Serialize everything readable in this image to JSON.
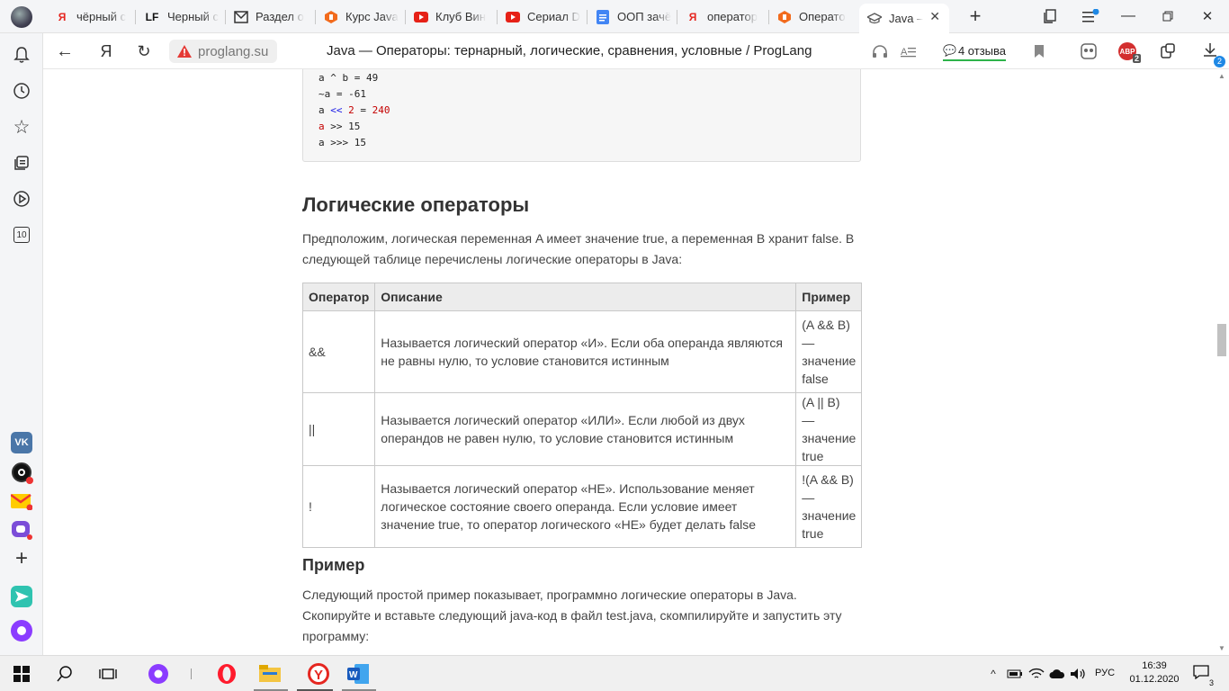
{
  "tabs": [
    {
      "label": "чёрный с",
      "favicon": "yandex-favicon"
    },
    {
      "label": "Черный с",
      "favicon": "lf-favicon"
    },
    {
      "label": "Раздел о",
      "favicon": "gmail-favicon"
    },
    {
      "label": "Курс Java",
      "favicon": "hexlet-favicon"
    },
    {
      "label": "Клуб Вин",
      "favicon": "youtube-favicon"
    },
    {
      "label": "Сериал D",
      "favicon": "youtube-favicon"
    },
    {
      "label": "ООП зачё",
      "favicon": "docs-favicon"
    },
    {
      "label": "оператор",
      "favicon": "yandex-favicon"
    },
    {
      "label": "Операто",
      "favicon": "hexlet-favicon"
    },
    {
      "label": "Java —",
      "favicon": "proglang-favicon"
    }
  ],
  "toolbar": {
    "url": "proglang.su",
    "page_title": "Java — Операторы: тернарный, логические, сравнения, условные / ProgLang",
    "reviews": "4 отзыва",
    "adblock_badge": "2",
    "downloads_badge": "2"
  },
  "leftbar": {
    "counter": "10"
  },
  "code_lines": [
    {
      "a": "a ^ b = 49"
    },
    {
      "a": "~a = -61"
    },
    {
      "a": "a ",
      "b": "<<",
      "c": " ",
      "d": "2",
      "e": " = ",
      "f": "240"
    },
    {
      "a": "a",
      "b": " >> 15"
    },
    {
      "a": "a >>> 15"
    }
  ],
  "section": {
    "heading": "Логические операторы",
    "intro": "Предположим, логическая переменная A имеет значение true, а переменная B хранит false. В следующей таблице перечислены логические операторы в Java:"
  },
  "table": {
    "headers": [
      "Оператор",
      "Описание",
      "Пример"
    ],
    "rows": [
      {
        "op": "&&",
        "desc": "Называется логический оператор «И». Если оба операнда являются не равны нулю, то условие становится истинным",
        "ex": "(A && B) — значение false"
      },
      {
        "op": "||",
        "desc": "Называется логический оператор «ИЛИ». Если любой из двух операндов не равен нулю, то условие становится истинным",
        "ex": "(A || B) — значение true"
      },
      {
        "op": "!",
        "desc": "Называется логический оператор «НЕ». Использование меняет логическое состояние своего операнда. Если условие имеет значение true, то оператор логического «НЕ» будет делать false",
        "ex": "!(A && B) — значение true"
      }
    ]
  },
  "example": {
    "heading": "Пример",
    "text": "Следующий простой пример показывает, программно логические операторы в Java. Скопируйте и вставьте следующий java-код в файл test.java, скомпилируйте и запустить эту программу:"
  },
  "taskbar": {
    "lang": "РУС",
    "time": "16:39",
    "date": "01.12.2020",
    "notif_count": "3"
  }
}
